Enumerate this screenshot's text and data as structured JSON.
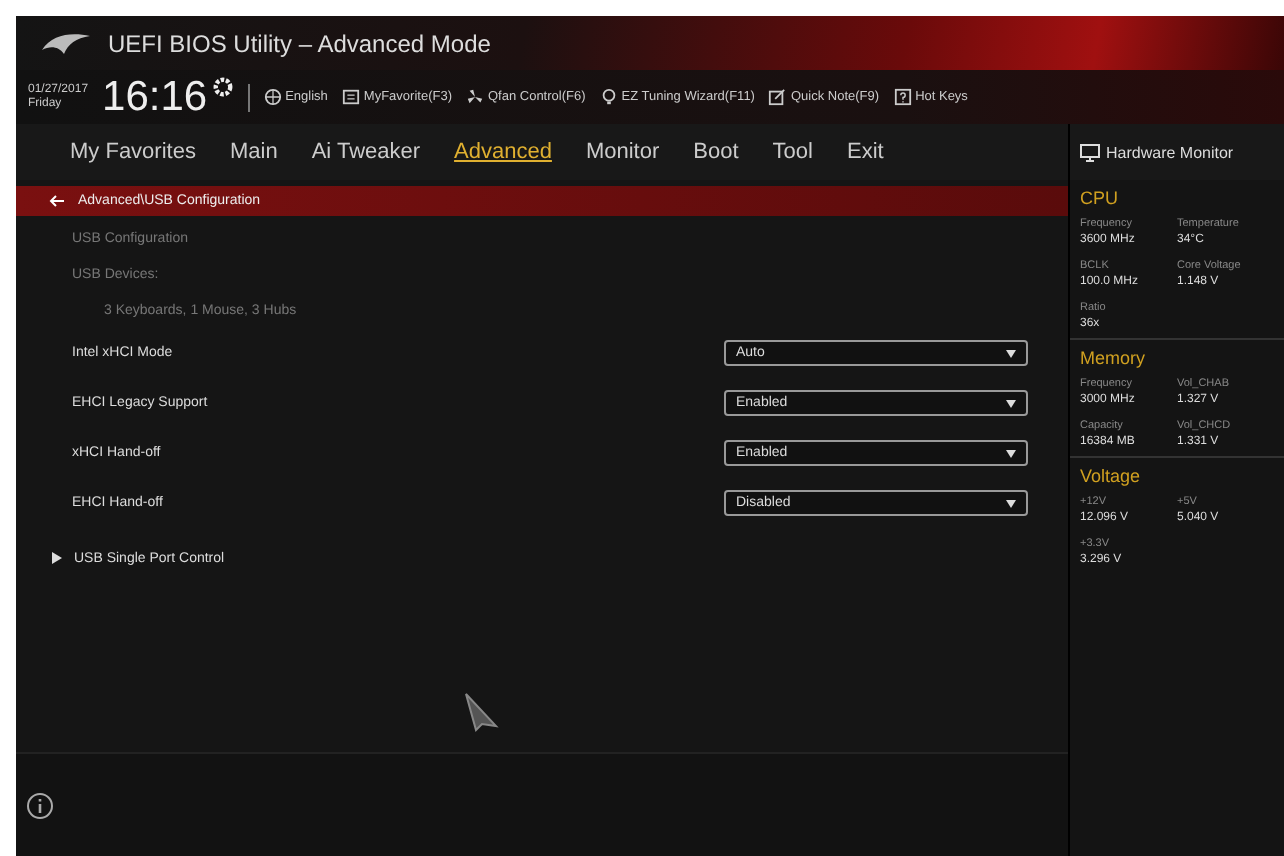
{
  "window": {
    "title": "UEFI BIOS Utility – Advanced Mode"
  },
  "info_bar": {
    "date": "01/27/2017",
    "day": "Friday",
    "time": "16:16",
    "items": [
      {
        "kind": "globe",
        "label": "English"
      },
      {
        "kind": "star",
        "label": "MyFavorite(F3)"
      },
      {
        "kind": "fan",
        "label": "Qfan Control(F6)"
      },
      {
        "kind": "bulb",
        "label": "EZ Tuning Wizard(F11)"
      },
      {
        "kind": "note",
        "label": "Quick Note(F9)"
      },
      {
        "kind": "key",
        "label": "Hot Keys"
      }
    ]
  },
  "tabs": [
    {
      "label": "My Favorites",
      "selected": false
    },
    {
      "label": "Main",
      "selected": false
    },
    {
      "label": "Ai Tweaker",
      "selected": false
    },
    {
      "label": "Advanced",
      "selected": true
    },
    {
      "label": "Monitor",
      "selected": false
    },
    {
      "label": "Boot",
      "selected": false
    },
    {
      "label": "Tool",
      "selected": false
    },
    {
      "label": "Exit",
      "selected": false
    }
  ],
  "breadcrumb": "Advanced\\USB Configuration",
  "settings": [
    {
      "kind": "heading",
      "label": "USB Configuration"
    },
    {
      "kind": "heading",
      "label": "USB Devices:"
    },
    {
      "kind": "detail",
      "label": "3 Keyboards, 1 Mouse, 3 Hubs"
    },
    {
      "kind": "dropdown",
      "label": "Intel xHCI Mode",
      "value": "Auto"
    },
    {
      "kind": "dropdown",
      "label": "EHCI Legacy Support",
      "value": "Enabled"
    },
    {
      "kind": "dropdown",
      "label": "xHCI Hand-off",
      "value": "Enabled"
    },
    {
      "kind": "dropdown",
      "label": "EHCI Hand-off",
      "value": "Disabled"
    },
    {
      "kind": "submenu",
      "label": "USB Single Port Control"
    }
  ],
  "hardware_monitor": {
    "title": "Hardware Monitor",
    "sections": [
      {
        "title": "CPU",
        "readings": [
          {
            "label": "Frequency",
            "value": "3600 MHz"
          },
          {
            "label": "Temperature",
            "value": "34°C"
          },
          {
            "label": "BCLK",
            "value": "100.0 MHz"
          },
          {
            "label": "Core Voltage",
            "value": "1.148 V"
          },
          {
            "label": "Ratio",
            "value": "36x"
          }
        ]
      },
      {
        "title": "Memory",
        "readings": [
          {
            "label": "Frequency",
            "value": "3000 MHz"
          },
          {
            "label": "Vol_CHAB",
            "value": "1.327 V"
          },
          {
            "label": "Capacity",
            "value": "16384 MB"
          },
          {
            "label": "Vol_CHCD",
            "value": "1.331 V"
          }
        ]
      },
      {
        "title": "Voltage",
        "readings": [
          {
            "label": "+12V",
            "value": "12.096 V"
          },
          {
            "label": "+5V",
            "value": "5.040 V"
          },
          {
            "label": "+3.3V",
            "value": "3.296 V"
          }
        ]
      }
    ]
  }
}
